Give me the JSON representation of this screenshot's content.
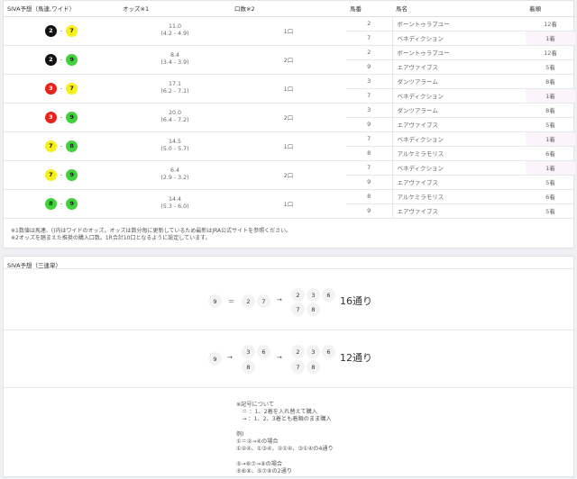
{
  "wide": {
    "headers": {
      "combo": "SIVA予想（馬連,ワイド）",
      "odds": "オッズ※1",
      "units": "口数※2",
      "horse_no": "馬番",
      "horse_name": "馬名",
      "rank": "着順"
    },
    "rows": [
      {
        "a": "2",
        "b": "7",
        "odds": "11.0",
        "range": "(4.2 - 4.9)",
        "units": "1口",
        "horses": [
          {
            "no": "2",
            "name": "ボーントゥラブユー",
            "rank": "12着"
          },
          {
            "no": "7",
            "name": "ベネディクション",
            "rank": "1着"
          }
        ]
      },
      {
        "a": "2",
        "b": "9",
        "odds": "8.4",
        "range": "(3.4 - 3.9)",
        "units": "2口",
        "horses": [
          {
            "no": "2",
            "name": "ボーントゥラブユー",
            "rank": "12着"
          },
          {
            "no": "9",
            "name": "エアヴァイブス",
            "rank": "5着"
          }
        ]
      },
      {
        "a": "3",
        "b": "7",
        "odds": "17.1",
        "range": "(6.2 - 7.1)",
        "units": "1口",
        "horses": [
          {
            "no": "3",
            "name": "ダンツアラーム",
            "rank": "8着"
          },
          {
            "no": "7",
            "name": "ベネディクション",
            "rank": "1着"
          }
        ]
      },
      {
        "a": "3",
        "b": "9",
        "odds": "20.0",
        "range": "(6.4 - 7.2)",
        "units": "2口",
        "horses": [
          {
            "no": "3",
            "name": "ダンツアラーム",
            "rank": "8着"
          },
          {
            "no": "9",
            "name": "エアヴァイブス",
            "rank": "5着"
          }
        ]
      },
      {
        "a": "7",
        "b": "8",
        "odds": "14.5",
        "range": "(5.0 - 5.7)",
        "units": "1口",
        "horses": [
          {
            "no": "7",
            "name": "ベネディクション",
            "rank": "1着"
          },
          {
            "no": "8",
            "name": "アルケミラモリス",
            "rank": "6着"
          }
        ]
      },
      {
        "a": "7",
        "b": "9",
        "odds": "6.4",
        "range": "(2.9 - 3.2)",
        "units": "2口",
        "horses": [
          {
            "no": "7",
            "name": "ベネディクション",
            "rank": "1着"
          },
          {
            "no": "9",
            "name": "エアヴァイブス",
            "rank": "5着"
          }
        ]
      },
      {
        "a": "8",
        "b": "9",
        "odds": "14.4",
        "range": "(5.3 - 6.0)",
        "units": "1口",
        "horses": [
          {
            "no": "8",
            "name": "アルケミラモリス",
            "rank": "6着"
          },
          {
            "no": "9",
            "name": "エアヴァイブス",
            "rank": "5着"
          }
        ]
      }
    ],
    "notes": [
      "※1数値は馬連、()内はワイドのオッズ。オッズは数分毎に更新しているため最新はJRA公式サイトを参照ください。",
      "※2オッズを踏まえた推奨の購入口数。1R合計10口となるように設定しています。"
    ]
  },
  "colors": {
    "2": "#111111",
    "3": "#e8231d",
    "7": "#f5ef1a",
    "8": "#3fd23a",
    "9": "#3fd23a"
  },
  "trio": {
    "title": "SIVA予想（三連単）",
    "f1": {
      "first": "9",
      "sym": "＝",
      "second": [
        "2",
        "7"
      ],
      "arrow1": "→",
      "arrow2": "→",
      "third": [
        "2",
        "3",
        "6",
        "7",
        "8"
      ],
      "count": "16通り"
    },
    "f2": {
      "first": "9",
      "arrow1": "→",
      "second": [
        "3",
        "6",
        "8"
      ],
      "arrow2": "→",
      "third": [
        "2",
        "3",
        "6",
        "7",
        "8"
      ],
      "count": "12通り"
    },
    "legend": "※記号について\n　＝ ：1、2着を入れ替えて購入\n　→ ：1、2、3着とも着順のまま購入\n\n例)\n①＝②→④の場合\n①②④、①③④、②①④、③①④の4通り\n\n⑤→⑥⑦→⑧の場合\n⑤⑥⑧、⑤⑦⑧の2通り"
  }
}
